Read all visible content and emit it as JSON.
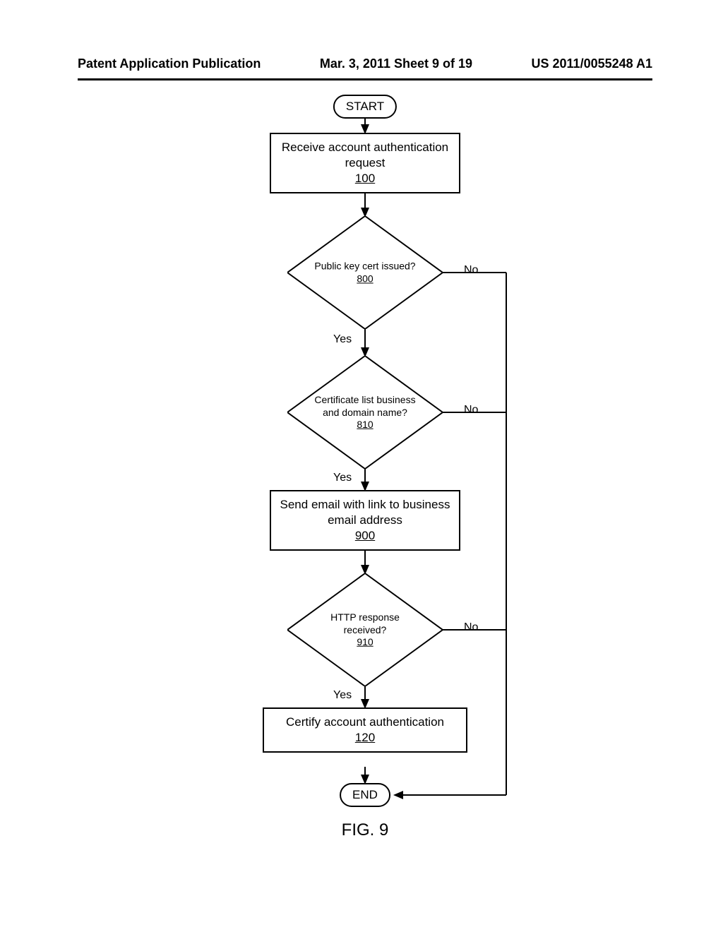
{
  "header": {
    "left": "Patent Application Publication",
    "center": "Mar. 3, 2011  Sheet 9 of 19",
    "right": "US 2011/0055248 A1"
  },
  "flow": {
    "start": "START",
    "end": "END",
    "step100": {
      "text": "Receive account authentication request",
      "ref": "100"
    },
    "dec800": {
      "text": "Public key cert issued?",
      "ref": "800"
    },
    "dec810": {
      "text": "Certificate list business and domain name?",
      "ref": "810"
    },
    "step900": {
      "text": "Send email with link to business email address",
      "ref": "900"
    },
    "dec910": {
      "text": "HTTP response received?",
      "ref": "910"
    },
    "step120": {
      "text": "Certify account authentication",
      "ref": "120"
    },
    "yes": "Yes",
    "no": "No"
  },
  "caption": "FIG. 9"
}
